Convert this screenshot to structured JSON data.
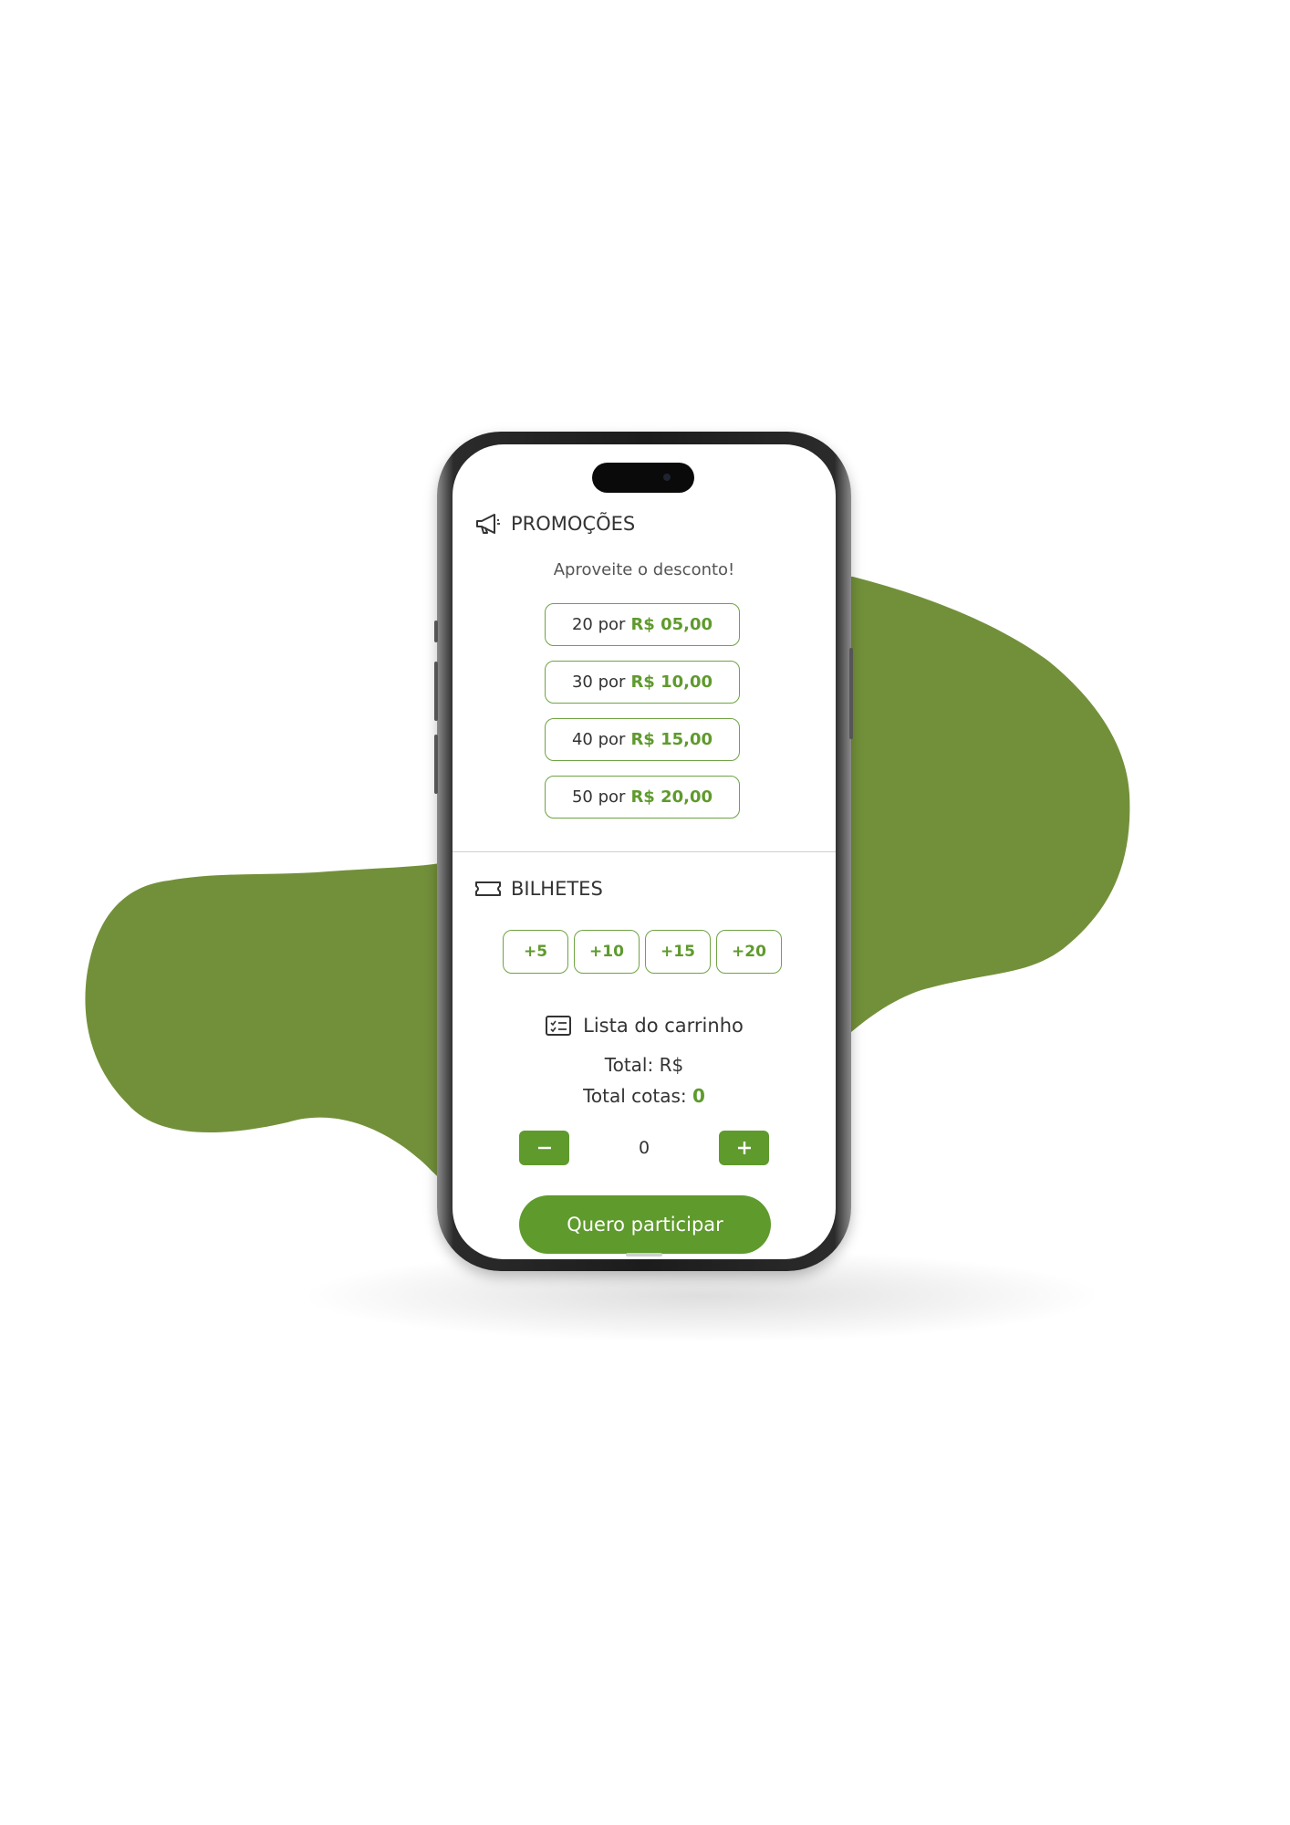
{
  "theme": {
    "accent": "#5f9a2d",
    "blob": "#72903a",
    "border": "#6fa344"
  },
  "promocoes": {
    "icon": "megaphone-icon",
    "title": "PROMOÇÕES",
    "subtitle": "Aproveite o desconto!",
    "offers": [
      {
        "qty_label": "20 por",
        "price": "R$ 05,00"
      },
      {
        "qty_label": "30 por",
        "price": "R$ 10,00"
      },
      {
        "qty_label": "40 por",
        "price": "R$ 15,00"
      },
      {
        "qty_label": "50 por",
        "price": "R$ 20,00"
      }
    ]
  },
  "bilhetes": {
    "icon": "ticket-icon",
    "title": "BILHETES",
    "quick_add": [
      "+5",
      "+10",
      "+15",
      "+20"
    ]
  },
  "cart": {
    "icon": "list-icon",
    "title": "Lista do carrinho",
    "total_label": "Total: R$",
    "cotas_label": "Total cotas:",
    "cotas_value": "0",
    "quantity": "0",
    "minus_icon": "minus-icon",
    "plus_icon": "plus-icon",
    "cta_label": "Quero participar"
  }
}
